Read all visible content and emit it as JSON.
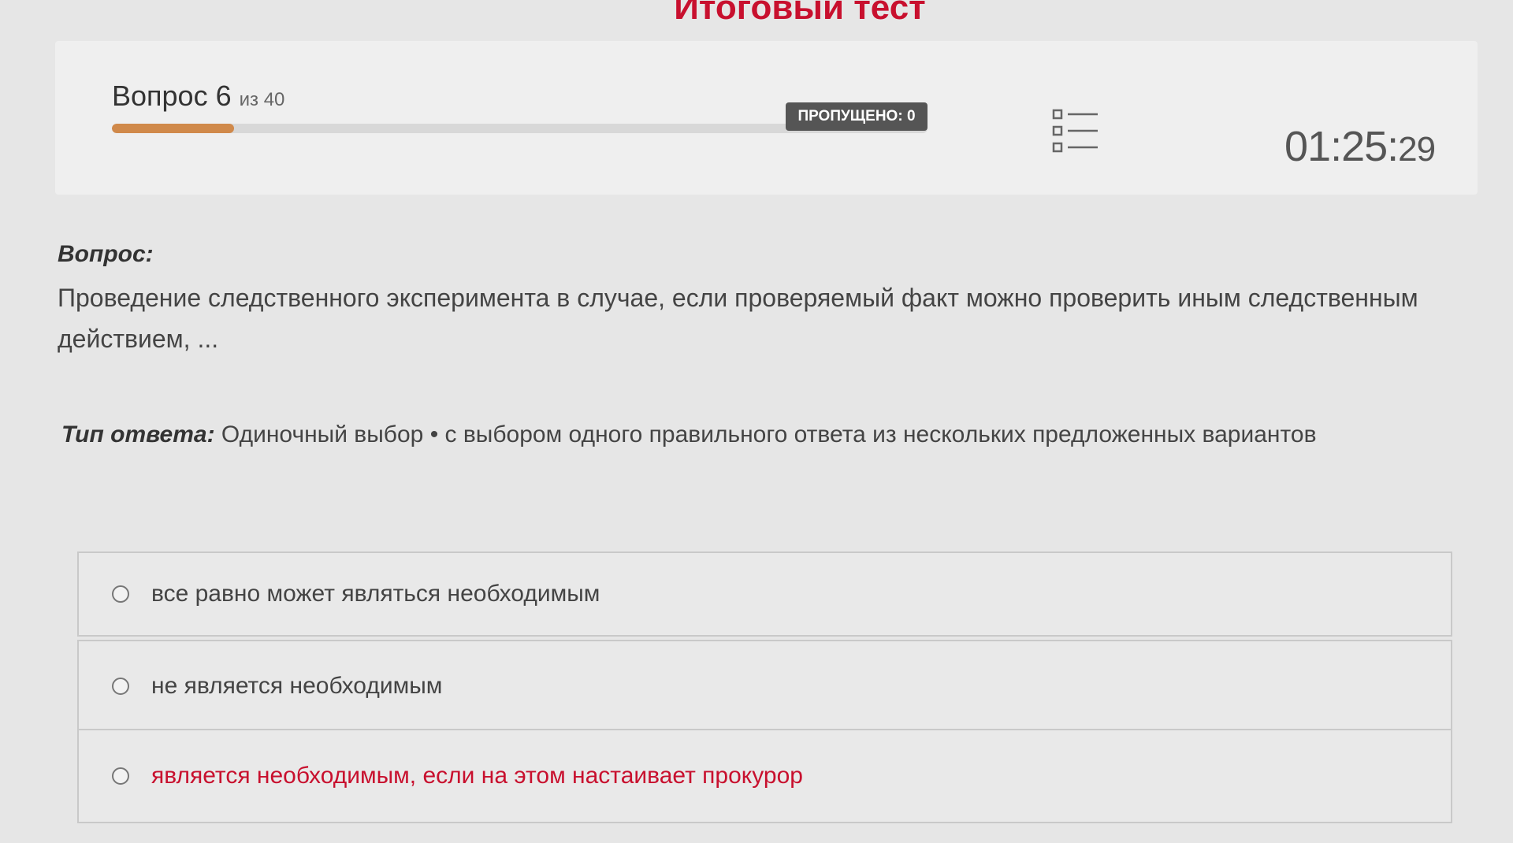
{
  "page": {
    "title": "Итоговый тест"
  },
  "header": {
    "question_word": "Вопрос 6",
    "of_total": "из 40",
    "progress_fraction": 0.15,
    "skipped_label": "ПРОПУЩЕНО: 0",
    "list_icon": "list-icon",
    "timer_main": "01:25:",
    "timer_seconds": "29"
  },
  "question": {
    "label": "Вопрос:",
    "text": "Проведение следственного эксперимента в случае, если проверяемый факт можно проверить иным следственным действием, ..."
  },
  "answer_type": {
    "label": "Тип ответа:",
    "value": "Одиночный выбор • с выбором одного правильного ответа из нескольких предложенных вариантов"
  },
  "options": [
    {
      "label": "все равно может являться необходимым"
    },
    {
      "label": "не является необходимым"
    },
    {
      "label": "является необходимым, если на этом настаивает прокурор"
    }
  ],
  "colors": {
    "accent": "#c8102e",
    "progress": "#d0894a",
    "badge": "#555555"
  }
}
